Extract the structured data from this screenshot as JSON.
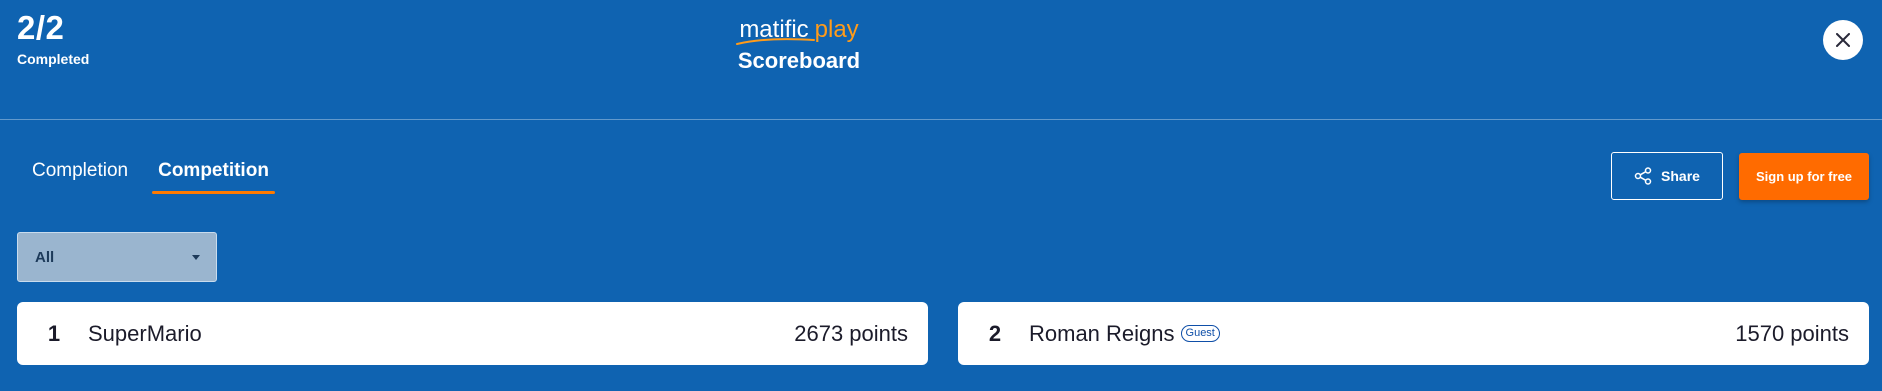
{
  "progress": {
    "count": "2/2",
    "label": "Completed"
  },
  "brand": {
    "logo_main": "matific",
    "logo_play": "play",
    "title": "Scoreboard"
  },
  "close": {
    "icon": "close-icon"
  },
  "tabs": [
    {
      "label": "Completion",
      "active": false
    },
    {
      "label": "Competition",
      "active": true
    }
  ],
  "actions": {
    "share_label": "Share",
    "signup_label": "Sign up for free"
  },
  "filter": {
    "selected": "All"
  },
  "leaderboard": [
    {
      "rank": "1",
      "name": "SuperMario",
      "badge": "",
      "points": "2673 points"
    },
    {
      "rank": "2",
      "name": "Roman Reigns",
      "badge": "Guest",
      "points": "1570 points"
    }
  ],
  "colors": {
    "background": "#0f63b1",
    "accent": "#ff6b00",
    "logo_play": "#ff9b1a"
  }
}
